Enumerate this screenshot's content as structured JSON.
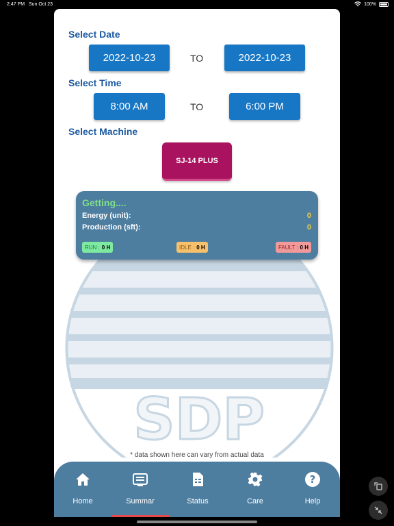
{
  "status_bar": {
    "time": "2:47 PM",
    "date": "Sun Oct 23",
    "battery": "100%"
  },
  "date_section": {
    "label": "Select Date",
    "from": "2022-10-23",
    "to_label": "TO",
    "to": "2022-10-23"
  },
  "time_section": {
    "label": "Select Time",
    "from": "8:00 AM",
    "to_label": "TO",
    "to": "6:00 PM"
  },
  "machine_section": {
    "label": "Select Machine",
    "machine": "SJ-14 PLUS"
  },
  "summary_card": {
    "title": "Getting....",
    "energy_label": "Energy  (unit):",
    "energy_value": "0",
    "production_label": "Production (sft):",
    "production_value": "0",
    "run_label": "RUN :",
    "run_value": "0 H",
    "idle_label": "IDLE :",
    "idle_value": "0 H",
    "fault_label": "FAULT :",
    "fault_value": "0 H"
  },
  "logo_text": "SDP",
  "footnote": "* data shown here can vary from actual data",
  "tabs": [
    {
      "label": "Home",
      "icon": "home-icon"
    },
    {
      "label": "Summar",
      "icon": "summary-icon"
    },
    {
      "label": "Status",
      "icon": "status-icon"
    },
    {
      "label": "Care",
      "icon": "gear-icon"
    },
    {
      "label": "Help",
      "icon": "help-icon"
    }
  ],
  "active_tab": 1,
  "colors": {
    "accent_blue": "#1877c4",
    "machine": "#a8125e",
    "tabbar": "#4d7d9f",
    "label_blue": "#1d5aa0"
  }
}
